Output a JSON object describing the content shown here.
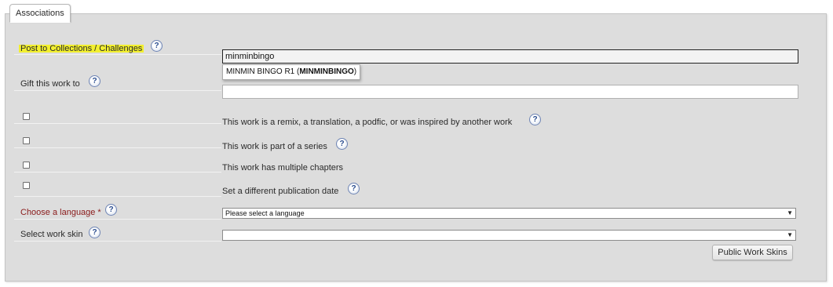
{
  "fieldset": {
    "legend": "Associations"
  },
  "collections": {
    "label": "Post to Collections / Challenges",
    "value": "minminbingo",
    "autocomplete": {
      "prefix": "MINMIN BINGO R1 (",
      "match": "MINMINBINGO",
      "suffix": ")"
    }
  },
  "gift": {
    "label": "Gift this work to",
    "value": ""
  },
  "options": [
    {
      "text": "This work is a remix, a translation, a podfic, or was inspired by another work",
      "checked": false,
      "help": true
    },
    {
      "text": "This work is part of a series",
      "checked": false,
      "help": true
    },
    {
      "text": "This work has multiple chapters",
      "checked": false,
      "help": false
    },
    {
      "text": "Set a different publication date",
      "checked": false,
      "help": true
    }
  ],
  "language": {
    "label": "Choose a language",
    "required_mark": "*",
    "selected": "Please select a language"
  },
  "skin": {
    "label": "Select work skin",
    "selected": "",
    "button_label": "Public Work Skins"
  },
  "help_glyph": "?",
  "colors": {
    "highlight": "#f2ef2f",
    "required": "#8a1a1a",
    "panel": "#dddddd"
  }
}
